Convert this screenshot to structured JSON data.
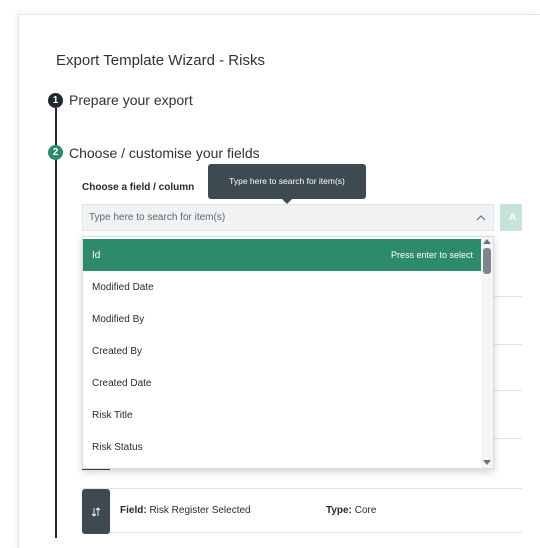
{
  "wizard": {
    "title": "Export Template Wizard - Risks"
  },
  "steps": [
    {
      "number": "1",
      "label": "Prepare your export",
      "color": "#1e2a2f"
    },
    {
      "number": "2",
      "label": "Choose / customise your fields",
      "color": "#2e8b6a"
    }
  ],
  "field_chooser": {
    "label": "Choose a field / column",
    "tooltip": "Type here to search for item(s)",
    "search_placeholder": "Type here to search for item(s)",
    "search_value": "",
    "collapse_icon": "chevron-up-icon",
    "add_button_label": "A"
  },
  "dropdown": {
    "selected_hint": "Press enter to select",
    "items": [
      "Id",
      "Modified Date",
      "Modified By",
      "Created By",
      "Created Date",
      "Risk Title",
      "Risk Status"
    ],
    "selected_index": 0
  },
  "field_rows": [
    {
      "handle_icon": "sort-arrows-icon",
      "field_key": "Field:",
      "field_value": "Risk Register Selected",
      "type_key": "Type:",
      "type_value": "Core"
    }
  ],
  "colors": {
    "accent_green": "#2e8b6a",
    "dark": "#1e2a2f",
    "tooltip_bg": "#3d4a52"
  }
}
